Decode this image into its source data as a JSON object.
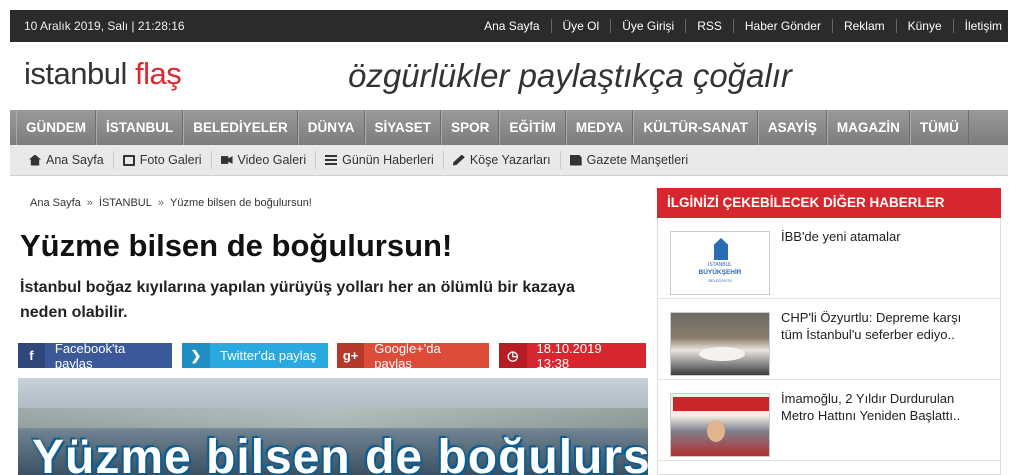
{
  "topbar": {
    "datetime": "10 Aralık 2019, Salı | 21:28:16",
    "links": [
      "Ana Sayfa",
      "Üye Ol",
      "Üye Girişi",
      "RSS",
      "Haber Gönder",
      "Reklam",
      "Künye",
      "İletişim"
    ]
  },
  "brand": {
    "logo_part1": "istanbul ",
    "logo_part2": "flaş",
    "slogan": "özgürlükler paylaştıkça çoğalır"
  },
  "mainnav": [
    "GÜNDEM",
    "İSTANBUL",
    "BELEDİYELER",
    "DÜNYA",
    "SİYASET",
    "SPOR",
    "EĞİTİM",
    "MEDYA",
    "KÜLTÜR-SANAT",
    "ASAYİŞ",
    "MAGAZİN",
    "TÜMÜ"
  ],
  "subnav": [
    {
      "label": "Ana Sayfa",
      "icon": "home-icon"
    },
    {
      "label": "Foto Galeri",
      "icon": "photo-icon"
    },
    {
      "label": "Video Galeri",
      "icon": "video-icon"
    },
    {
      "label": "Günün Haberleri",
      "icon": "list-icon"
    },
    {
      "label": "Köşe Yazarları",
      "icon": "pen-icon"
    },
    {
      "label": "Gazete Manşetleri",
      "icon": "newspaper-icon"
    }
  ],
  "breadcrumb": {
    "home": "Ana Sayfa",
    "sep": "»",
    "category": "İSTANBUL",
    "current": "Yüzme bilsen de boğulursun!"
  },
  "article": {
    "title": "Yüzme bilsen de boğulursun!",
    "summary": "İstanbul boğaz kıyılarına yapılan yürüyüş yolları her an ölümlü bir kazaya neden olabilir.",
    "image_caption": "Yüzme bilsen de boğulursun!"
  },
  "share": {
    "facebook_icon": "f",
    "facebook": "Facebook'ta paylaş",
    "twitter_icon": "❯",
    "twitter": "Twitter'da paylaş",
    "google_icon": "g+",
    "google": "Google+'da paylaş",
    "date_icon": "◷",
    "date": "18.10.2019 13:38"
  },
  "sidebar": {
    "title": "İLGİNİZİ ÇEKEBİLECEK DİĞER HABERLER",
    "items": [
      {
        "text": "İBB'de yeni atamalar",
        "logo_line1": "İSTANBUL",
        "logo_line2": "BÜYÜKŞEHİR",
        "logo_line3": "BELEDİYESİ"
      },
      {
        "text": "CHP'li Özyurtlu: Depreme karşı tüm İstanbul'u seferber ediyo.."
      },
      {
        "text": "İmamoğlu, 2 Yıldır Durdurulan Metro Hattını Yeniden Başlattı.."
      }
    ]
  },
  "colors": {
    "accent_red": "#d7262d",
    "facebook": "#3b5998",
    "twitter": "#2aa9e0",
    "google": "#dd4b39",
    "topbar": "#2b2b2b"
  }
}
